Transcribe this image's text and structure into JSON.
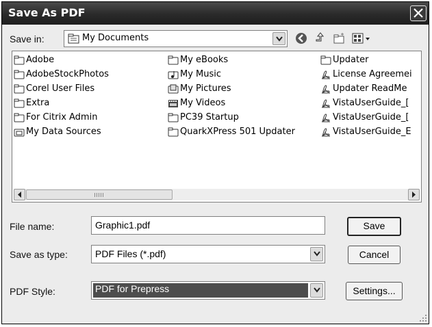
{
  "window": {
    "title": "Save As PDF"
  },
  "toolbar": {
    "save_in_label": "Save in:",
    "location": "My Documents",
    "icons": [
      "back-icon",
      "up-folder-icon",
      "new-folder-icon",
      "view-menu-icon"
    ]
  },
  "files": {
    "col1": [
      "Adobe",
      "AdobeStockPhotos",
      "Corel User Files",
      "Extra",
      "For Citrix Admin",
      "My Data Sources"
    ],
    "col2": [
      "My eBooks",
      "My Music",
      "My Pictures",
      "My Videos",
      "PC39 Startup",
      "QuarkXPress 501 Updater"
    ],
    "col3": [
      "Updater",
      "License Agreemei",
      "Updater ReadMe",
      "VistaUserGuide_[",
      "VistaUserGuide_[",
      "VistaUserGuide_E"
    ]
  },
  "form": {
    "file_name_label": "File name:",
    "file_name_value": "Graphic1.pdf",
    "save_type_label": "Save as type:",
    "save_type_value": "PDF Files (*.pdf)",
    "pdf_style_label": "PDF Style:",
    "pdf_style_value": "PDF for Prepress"
  },
  "buttons": {
    "save": "Save",
    "cancel": "Cancel",
    "settings": "Settings..."
  },
  "colors": {
    "title_bar": "#2a2a2a",
    "dialog_bg": "#ececec",
    "highlight": "#4d4d4d"
  }
}
